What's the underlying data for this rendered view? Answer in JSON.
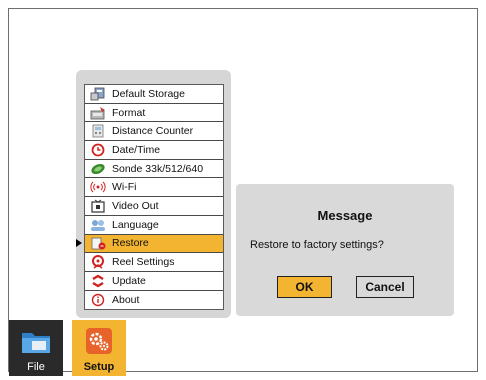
{
  "menu": {
    "items": [
      {
        "label": "Default Storage",
        "icon": "storage-icon"
      },
      {
        "label": "Format",
        "icon": "format-icon"
      },
      {
        "label": "Distance Counter",
        "icon": "distance-counter-icon"
      },
      {
        "label": "Date/Time",
        "icon": "clock-icon"
      },
      {
        "label": "Sonde 33k/512/640",
        "icon": "sonde-icon"
      },
      {
        "label": "Wi-Fi",
        "icon": "wifi-icon"
      },
      {
        "label": "Video Out",
        "icon": "video-out-icon"
      },
      {
        "label": "Language",
        "icon": "language-icon"
      },
      {
        "label": "Restore",
        "icon": "restore-icon"
      },
      {
        "label": "Reel Settings",
        "icon": "reel-icon"
      },
      {
        "label": "Update",
        "icon": "update-icon"
      },
      {
        "label": "About",
        "icon": "info-icon"
      }
    ],
    "selected_index": 8
  },
  "dialog": {
    "title": "Message",
    "text": "Restore to factory settings?",
    "ok_label": "OK",
    "cancel_label": "Cancel"
  },
  "tabs": {
    "file_label": "File",
    "setup_label": "Setup"
  },
  "colors": {
    "accent": "#f3b531",
    "panel": "#d6d6d6",
    "file_tab": "#2a2a2a"
  }
}
